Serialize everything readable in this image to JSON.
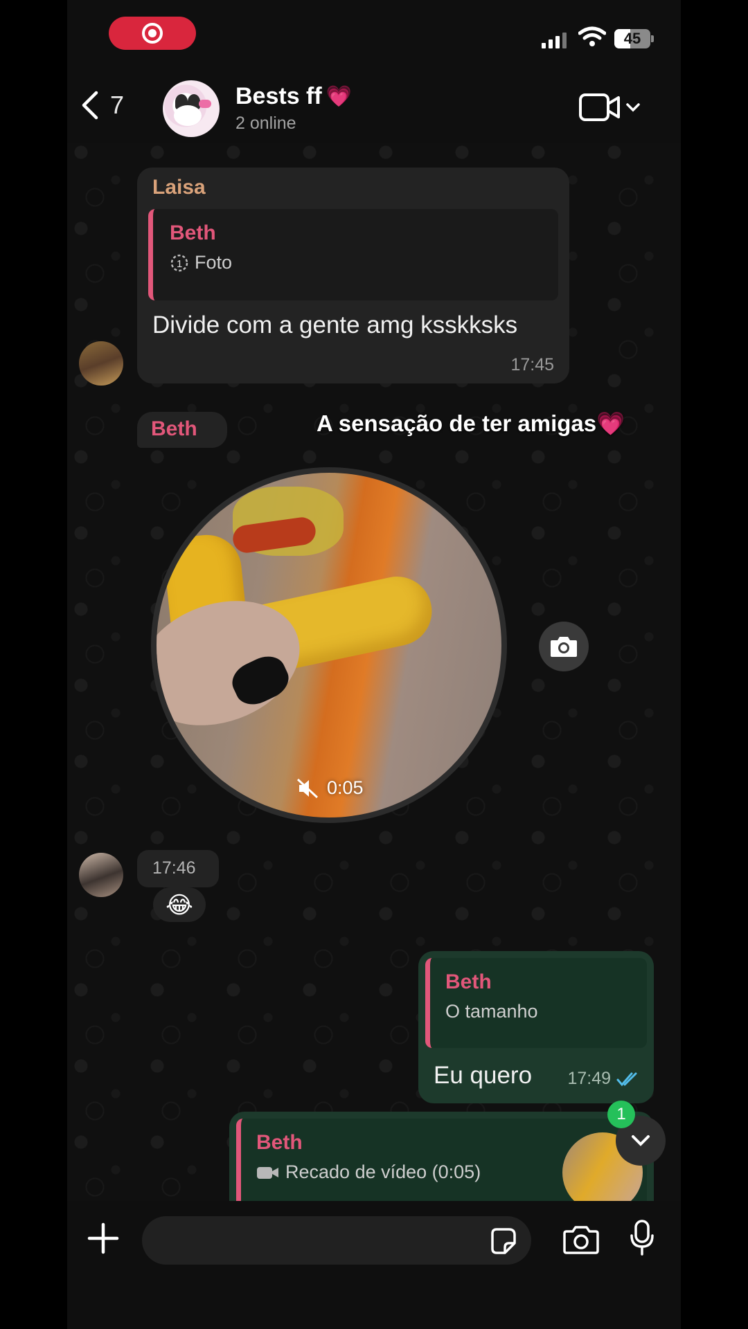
{
  "status_bar": {
    "battery": "45"
  },
  "header": {
    "back_count": "7",
    "group_name": "Bests ff",
    "group_emoji": "💗",
    "online_status": "2 online"
  },
  "messages": {
    "laisa_reply": {
      "sender": "Laisa",
      "quote_sender": "Beth",
      "quote_text": "Foto",
      "text": "Divide com a gente amg ksskksks",
      "time": "17:45"
    },
    "beth_video": {
      "sender": "Beth",
      "caption": "A sensação de ter amigas💗",
      "duration": "0:05",
      "time": "17:46",
      "reaction": "😂"
    },
    "my_reply": {
      "quote_sender": "Beth",
      "quote_text": "O tamanho",
      "text": "Eu quero",
      "time": "17:49"
    },
    "my_video_reply": {
      "quote_sender": "Beth",
      "quote_text": "Recado de vídeo (0:05)"
    }
  },
  "scroll_badge": "1",
  "composer": {
    "placeholder": ""
  },
  "colors": {
    "accent_pink": "#e2577a",
    "laisa_name": "#d9a27a",
    "outgoing_bubble": "#1d3a2c",
    "incoming_bubble": "#232323",
    "read_ticks": "#53bdeb",
    "record_pill": "#d9263d"
  }
}
